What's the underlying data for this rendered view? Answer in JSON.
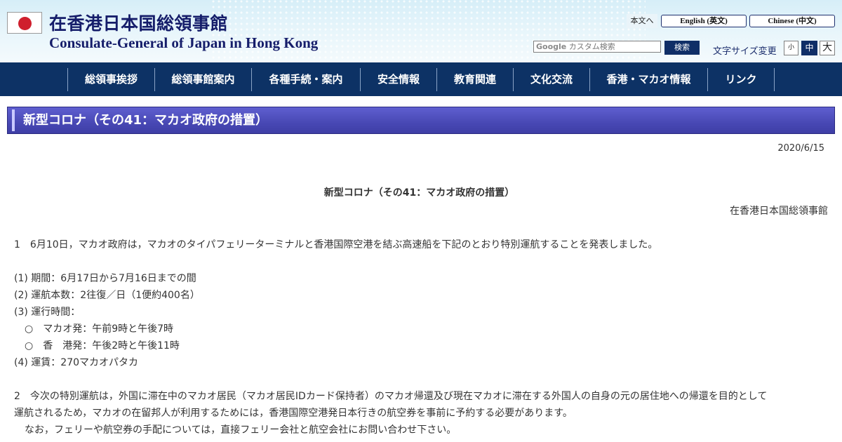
{
  "header": {
    "title_jp": "在香港日本国総領事館",
    "title_en": "Consulate-General of Japan in Hong Kong",
    "flag_icon": "japan-flag-icon",
    "skip_label": "本文へ",
    "lang_en": "English (英文)",
    "lang_zh": "Chinese (中文)",
    "search": {
      "logo": "Google",
      "placeholder": "カスタム検索",
      "button": "検索"
    },
    "fontsize": {
      "label": "文字サイズ変更",
      "small": "小",
      "medium": "中",
      "large": "大"
    }
  },
  "nav": {
    "items": [
      "総領事挨拶",
      "総領事館案内",
      "各種手続・案内",
      "安全情報",
      "教育関連",
      "文化交流",
      "香港・マカオ情報",
      "リンク"
    ]
  },
  "page": {
    "title": "新型コロナ（その41：マカオ政府の措置）",
    "date": "2020/6/15",
    "article_title": "新型コロナ（その41：マカオ政府の措置）",
    "org": "在香港日本国総領事館",
    "para1": "1　6月10日，マカオ政府は，マカオのタイパフェリーターミナルと香港国際空港を結ぶ高速船を下記のとおり特別運航することを発表しました。",
    "items": [
      "(1) 期間：6月17日から7月16日までの間",
      "(2) 運航本数：2往復／日（1便約400名）",
      "(3) 運行時間：",
      "○　マカオ発：午前9時と午後7時",
      "○　香　港発：午後2時と午後11時",
      "(4) 運賃：270マカオパタカ"
    ],
    "para2_line1": "2　今次の特別運航は，外国に滞在中のマカオ居民（マカオ居民IDカード保持者）のマカオ帰還及び現在マカオに滞在する外国人の自身の元の居住地への帰還を目的として",
    "para2_line2": "運航されるため，マカオの在留邦人が利用するためには，香港国際空港発日本行きの航空券を事前に予約する必要があります。",
    "para2_line3": "なお，フェリーや航空券の手配については，直接フェリー会社と航空会社にお問い合わせ下さい。"
  },
  "colors": {
    "nav_bg": "#0d3265",
    "title_bar": "#4848b4",
    "title_text": "#151d6a",
    "flag_red": "#cf1f2d"
  }
}
